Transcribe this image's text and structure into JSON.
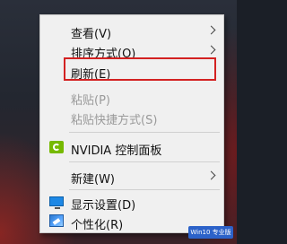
{
  "menu": {
    "items": [
      {
        "label": "查看(V)"
      },
      {
        "label": "排序方式(O)"
      },
      {
        "label": "刷新(E)"
      },
      {
        "label": "粘贴(P)"
      },
      {
        "label": "粘贴快捷方式(S)"
      },
      {
        "label": "NVIDIA 控制面板"
      },
      {
        "label": "新建(W)"
      },
      {
        "label": "显示设置(D)"
      },
      {
        "label": "个性化(R)"
      }
    ]
  },
  "icons": {
    "nvidia": "nvidia-icon",
    "display": "display-settings-icon",
    "personalize": "personalize-icon",
    "submenu": "chevron-right-icon"
  },
  "colors": {
    "highlight_border": "#d32121",
    "disabled_text": "#9a9a9a",
    "menu_bg": "#f0f0f0"
  },
  "watermark": {
    "text": "Win10 专业版"
  }
}
